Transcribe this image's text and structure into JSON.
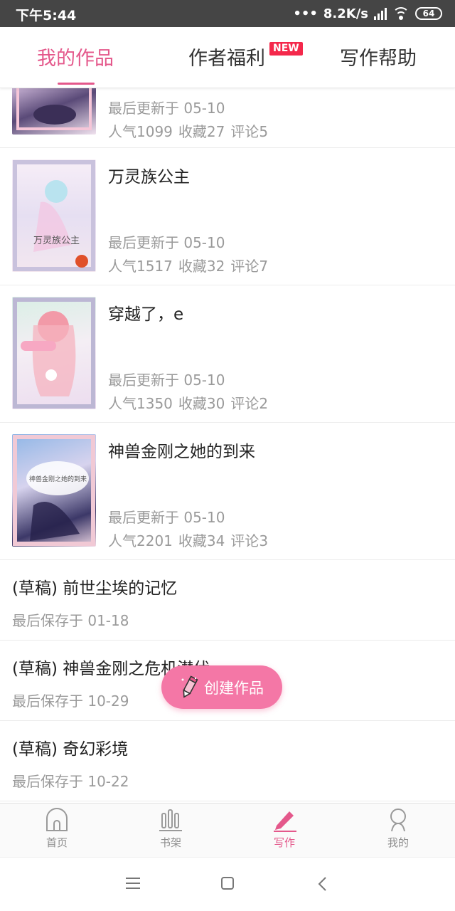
{
  "status_bar": {
    "time": "下午5:44",
    "network_speed": "8.2K/s",
    "battery": "64"
  },
  "tabs": [
    {
      "label": "我的作品",
      "active": true
    },
    {
      "label": "作者福利",
      "badge": "NEW"
    },
    {
      "label": "写作帮助"
    }
  ],
  "works": [
    {
      "title": "",
      "updated": "最后更新于 05-10",
      "popularity": "人气1099",
      "favorites": "收藏27",
      "comments": "评论5"
    },
    {
      "title": "万灵族公主",
      "updated": "最后更新于 05-10",
      "popularity": "人气1517",
      "favorites": "收藏32",
      "comments": "评论7"
    },
    {
      "title": "穿越了，e",
      "updated": "最后更新于 05-10",
      "popularity": "人气1350",
      "favorites": "收藏30",
      "comments": "评论2"
    },
    {
      "title": "神兽金刚之她的到来",
      "updated": "最后更新于 05-10",
      "popularity": "人气2201",
      "favorites": "收藏34",
      "comments": "评论3"
    }
  ],
  "drafts": [
    {
      "title": "(草稿) 前世尘埃的记忆",
      "saved": "最后保存于 01-18"
    },
    {
      "title": "(草稿) 神兽金刚之危机潜伏",
      "saved": "最后保存于 10-29"
    },
    {
      "title": "(草稿) 奇幻彩境",
      "saved": "最后保存于 10-22"
    }
  ],
  "fab": {
    "label": "创建作品",
    "icon": "pencil-icon"
  },
  "bottom_nav": [
    {
      "label": "首页",
      "icon": "home-icon"
    },
    {
      "label": "书架",
      "icon": "bookshelf-icon"
    },
    {
      "label": "写作",
      "icon": "pen-icon",
      "active": true
    },
    {
      "label": "我的",
      "icon": "profile-icon"
    }
  ],
  "colors": {
    "accent": "#e4588b",
    "fab": "#f477a6",
    "badge": "#f4284b",
    "status_bar": "#454545",
    "meta_text": "#9a9a9a"
  }
}
